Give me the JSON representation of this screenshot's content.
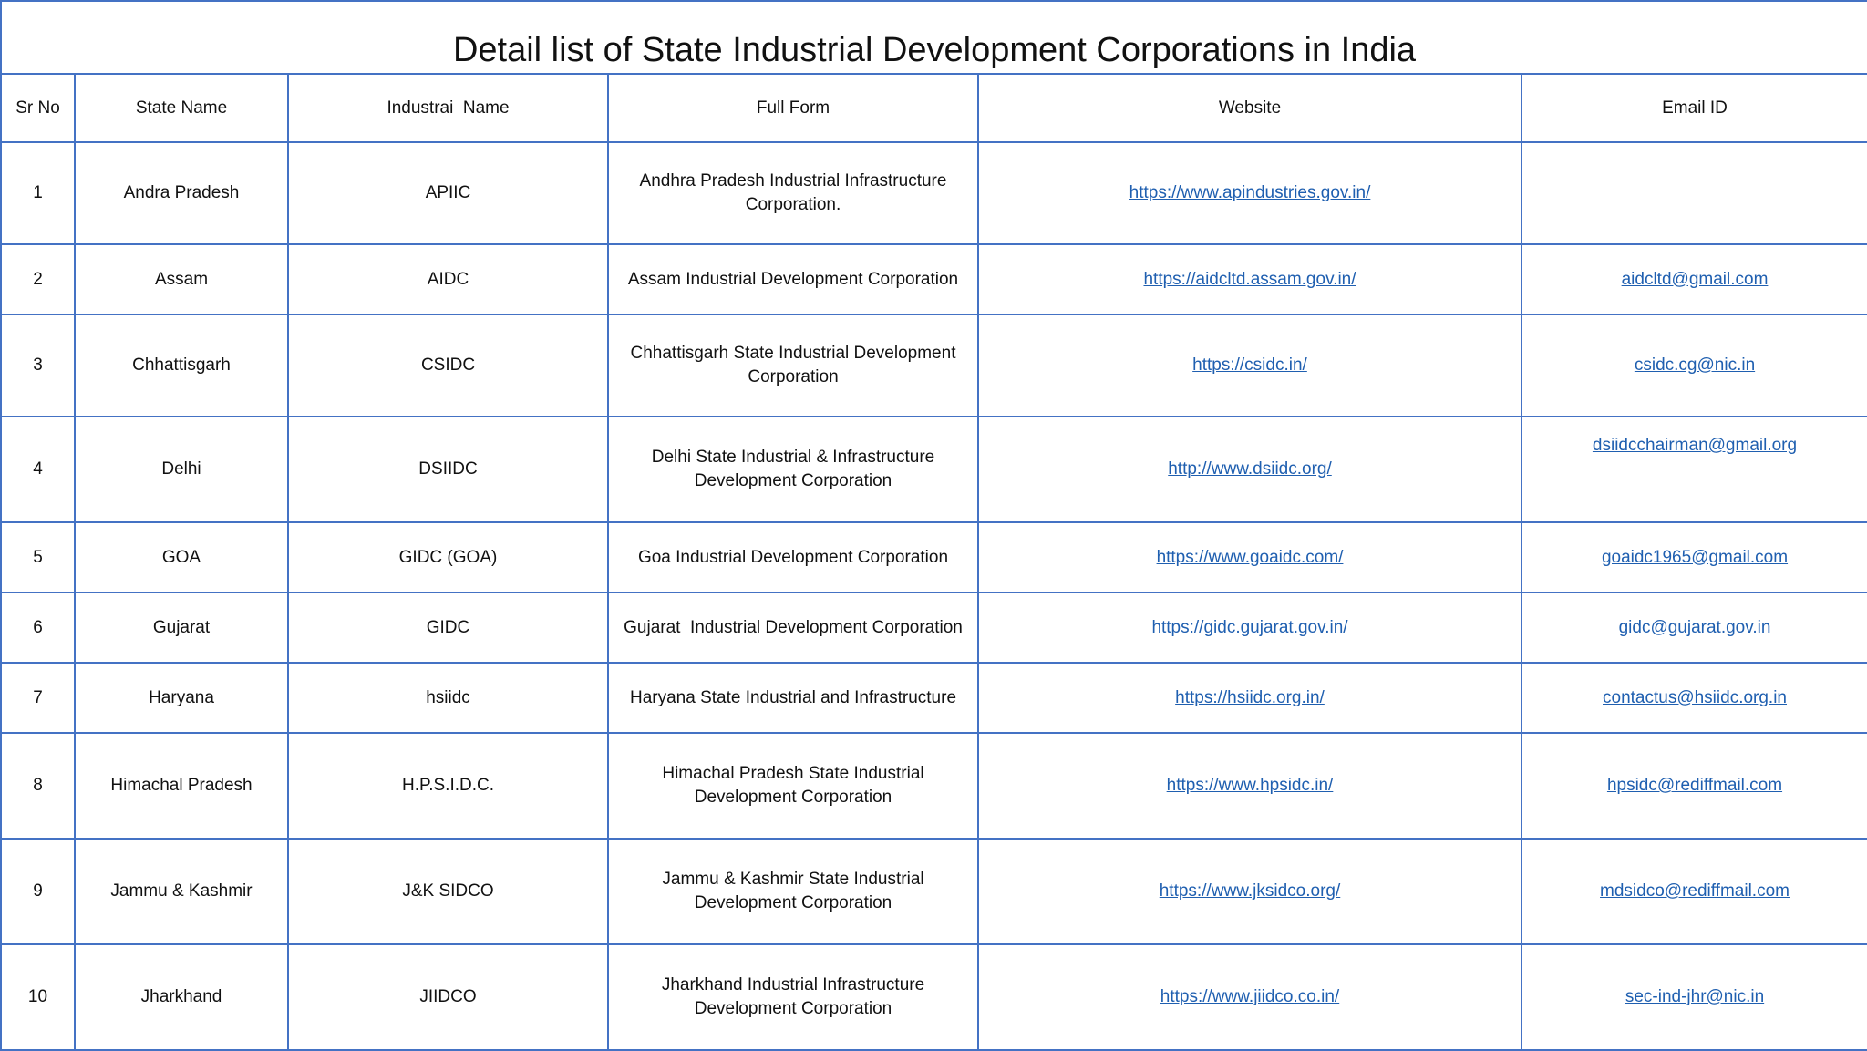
{
  "title": "Detail list of State Industrial Development Corporations in India",
  "headers": {
    "sr_no": "Sr No",
    "state_name": "State Name",
    "industrial_name": "Industrai  Name",
    "full_form": "Full Form",
    "website": "Website",
    "email": "Email ID"
  },
  "rows": [
    {
      "sr": "1",
      "state": "Andra Pradesh",
      "name": "APIIC",
      "full_form_1": "Andhra Pradesh Industrial Infrastructure",
      "full_form_2": "Corporation.",
      "website": "https://www.apindustries.gov.in/",
      "email": ""
    },
    {
      "sr": "2",
      "state": "Assam",
      "name": "AIDC",
      "full_form_1": "Assam Industrial Development Corporation",
      "full_form_2": "",
      "website": "https://aidcltd.assam.gov.in/",
      "email": "aidcltd@gmail.com"
    },
    {
      "sr": "3",
      "state": "Chhattisgarh",
      "name": "CSIDC",
      "full_form_1": "Chhattisgarh State Industrial Development",
      "full_form_2": "Corporation",
      "website": "https://csidc.in/",
      "email": "csidc.cg@nic.in"
    },
    {
      "sr": "4",
      "state": "Delhi",
      "name": "DSIIDC",
      "full_form_1": "Delhi State Industrial & Infrastructure",
      "full_form_2": "Development Corporation",
      "website": "http://www.dsiidc.org/",
      "email": "dsiidcchairman@gmail.org"
    },
    {
      "sr": "5",
      "state": "GOA",
      "name": "GIDC (GOA)",
      "full_form_1": "Goa Industrial Development Corporation",
      "full_form_2": "",
      "website": "https://www.goaidc.com/",
      "email": "goaidc1965@gmail.com"
    },
    {
      "sr": "6",
      "state": "Gujarat",
      "name": "GIDC",
      "full_form_1": "Gujarat  Industrial Development Corporation",
      "full_form_2": "",
      "website": "https://gidc.gujarat.gov.in/",
      "email": "gidc@gujarat.gov.in"
    },
    {
      "sr": "7",
      "state": "Haryana",
      "name": "hsiidc",
      "full_form_1": "Haryana State Industrial and Infrastructure",
      "full_form_2": "",
      "website": "https://hsiidc.org.in/",
      "email": "contactus@hsiidc.org.in"
    },
    {
      "sr": "8",
      "state": "Himachal Pradesh",
      "name": "H.P.S.I.D.C.",
      "full_form_1": "Himachal Pradesh State Industrial",
      "full_form_2": "Development Corporation",
      "website": "https://www.hpsidc.in/",
      "email": "hpsidc@rediffmail.com"
    },
    {
      "sr": "9",
      "state": "Jammu & Kashmir",
      "name": "J&K SIDCO",
      "full_form_1": "Jammu & Kashmir State Industrial",
      "full_form_2": "Development Corporation",
      "website": "https://www.jksidco.org/",
      "email": "mdsidco@rediffmail.com"
    },
    {
      "sr": "10",
      "state": "Jharkhand",
      "name": "JIIDCO",
      "full_form_1": "Jharkhand Industrial Infrastructure",
      "full_form_2": "Development Corporation",
      "website": "https://www.jiidco.co.in/",
      "email": "sec-ind-jhr@nic.in"
    }
  ]
}
